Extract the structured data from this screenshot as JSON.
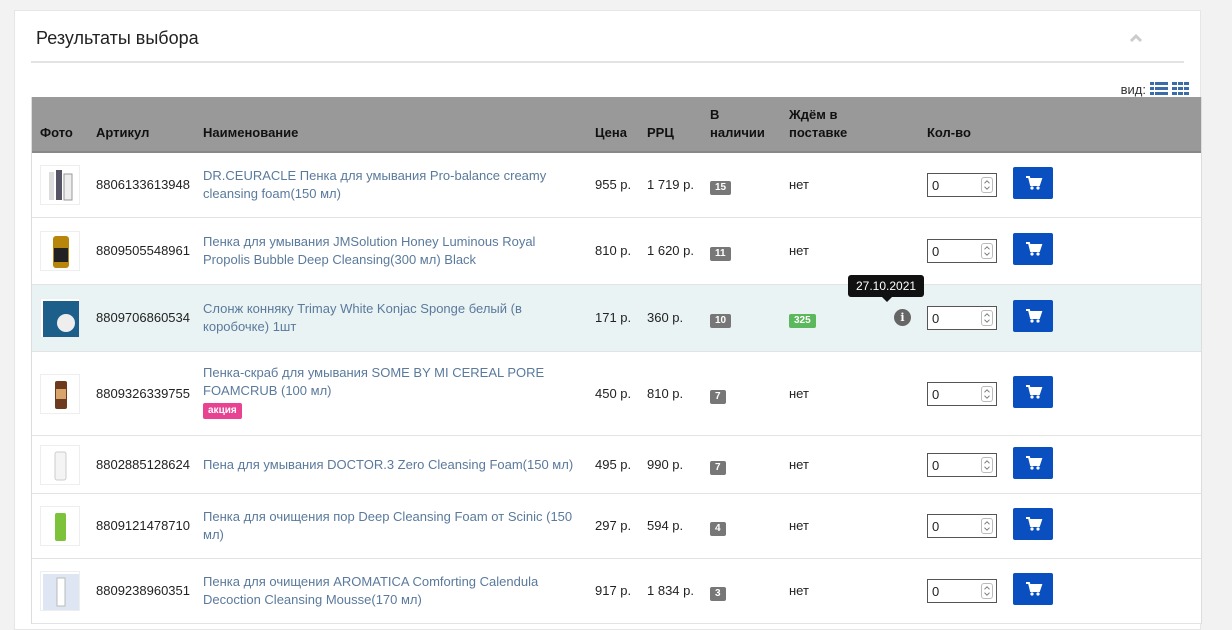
{
  "panel": {
    "title": "Результаты выбора",
    "view_label": "вид:"
  },
  "table": {
    "headers": {
      "photo": "Фото",
      "sku": "Артикул",
      "name": "Наименование",
      "price": "Цена",
      "rrp": "РРЦ",
      "stock_line1": "В",
      "stock_line2": "наличии",
      "awaiting_line1": "Ждём в",
      "awaiting_line2": "поставке",
      "qty": "Кол-во"
    },
    "rows": [
      {
        "sku": "8806133613948",
        "name_line1": "DR.CEURACLE Пенка для умывания Pro-balance creamy",
        "name_line2": "cleansing foam(150 мл)",
        "price": "955 р.",
        "rrp": "1 719 р.",
        "stock": "15",
        "awaiting": "нет",
        "qty": "0"
      },
      {
        "sku": "8809505548961",
        "name_line1": "Пенка для умывания JMSolution Honey Luminous Royal",
        "name_line2": "Propolis Bubble Deep Cleansing(300 мл) Black",
        "price": "810 р.",
        "rrp": "1 620 р.",
        "stock": "11",
        "awaiting": "нет",
        "qty": "0"
      },
      {
        "sku": "8809706860534",
        "name_line1": "Слонж конняку Trimay White Konjac Sponge белый (в",
        "name_line2": "коробочке) 1шт",
        "price": "171 р.",
        "rrp": "360 р.",
        "stock": "10",
        "awaiting": "325",
        "qty": "0",
        "tooltip": "27.10.2021"
      },
      {
        "sku": "8809326339755",
        "name_line1": "Пенка-скраб для умывания SOME BY MI CEREAL PORE",
        "name_line2": "FOAMCRUB (100 мл)",
        "promo": "акция",
        "price": "450 р.",
        "rrp": "810 р.",
        "stock": "7",
        "awaiting": "нет",
        "qty": "0"
      },
      {
        "sku": "8802885128624",
        "name_line1": "Пена для умывания DOCTOR.3 Zero Cleansing Foam(150 мл)",
        "name_line2": "",
        "price": "495 р.",
        "rrp": "990 р.",
        "stock": "7",
        "awaiting": "нет",
        "qty": "0"
      },
      {
        "sku": "8809121478710",
        "name_line1": "Пенка для очищения пор Deep Cleansing Foam от Scinic (150",
        "name_line2": "мл)",
        "price": "297 р.",
        "rrp": "594 р.",
        "stock": "4",
        "awaiting": "нет",
        "qty": "0"
      },
      {
        "sku": "8809238960351",
        "name_line1": "Пенка для очищения AROMATICA Comforting Calendula",
        "name_line2": "Decoction Cleansing Mousse(170 мл)",
        "price": "917 р.",
        "rrp": "1 834 р.",
        "stock": "3",
        "awaiting": "нет",
        "qty": "0"
      }
    ]
  },
  "colors": {
    "header_bg": "#999999",
    "cart_button": "#0a4fbf",
    "link": "#5a7a9c",
    "promo_badge": "#e84393",
    "awaiting_badge": "#5cb85c"
  }
}
